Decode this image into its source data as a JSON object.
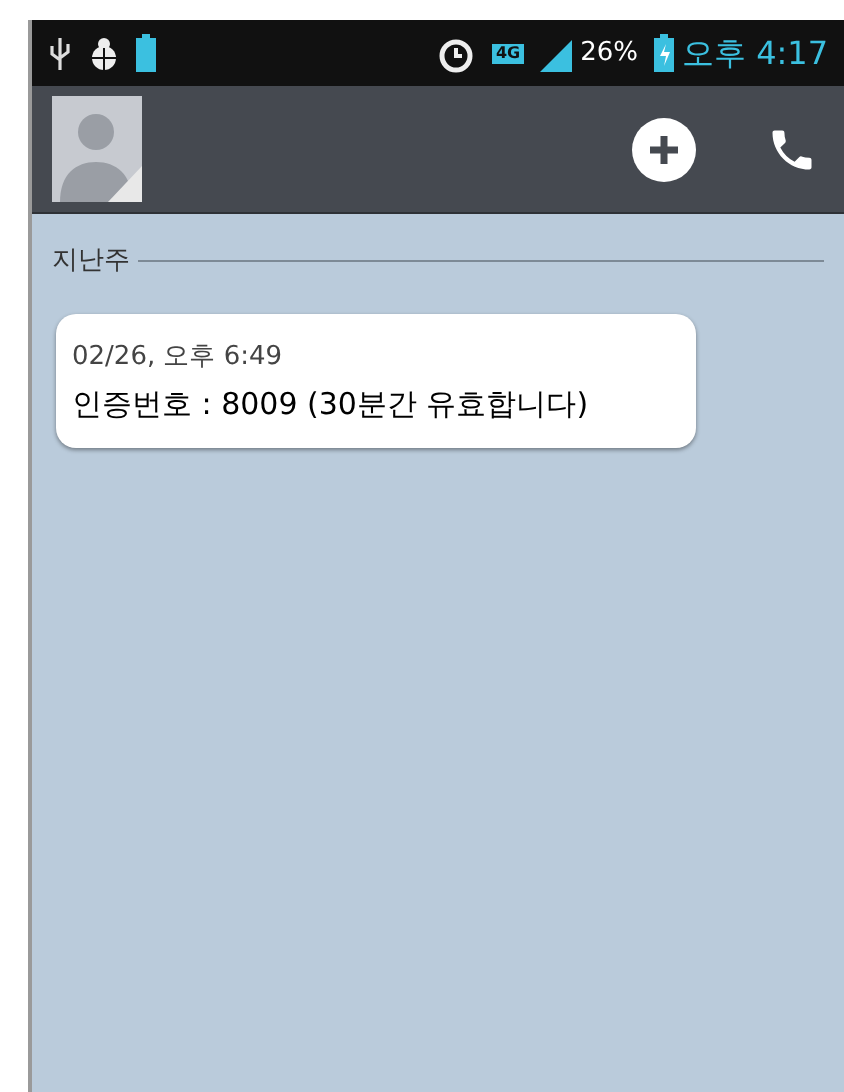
{
  "status_bar": {
    "network": "4G",
    "battery": "26%",
    "time": "오후 4:17"
  },
  "section": {
    "label": "지난주"
  },
  "messages": [
    {
      "timestamp": "02/26, 오후 6:49",
      "text": "인증번호 : 8009 (30분간 유효합니다)"
    }
  ]
}
